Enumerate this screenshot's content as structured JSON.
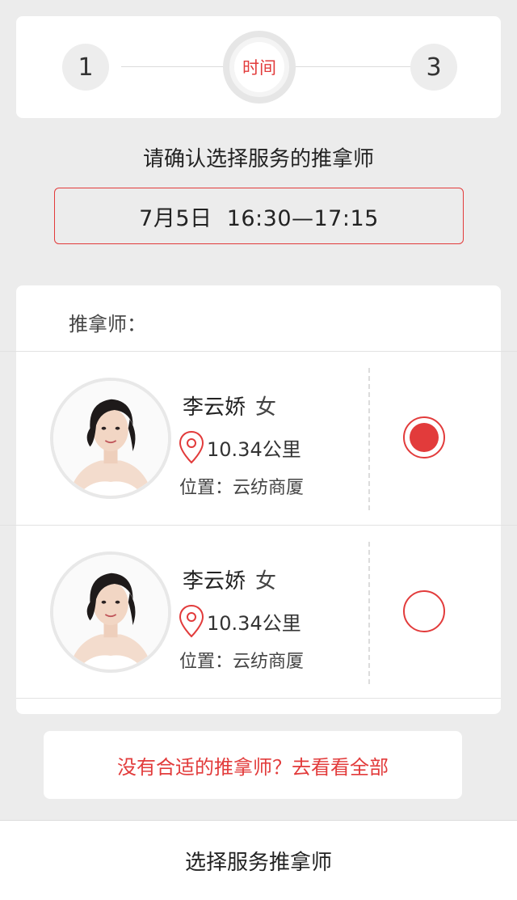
{
  "stepper": {
    "step1": "1",
    "step2": "时间",
    "step3": "3"
  },
  "confirm": {
    "title": "请确认选择服务的推拿师",
    "time_slot": "7月5日  16:30—17:15"
  },
  "list": {
    "header": "推拿师：",
    "therapists": [
      {
        "name": "李云娇",
        "gender": "女",
        "distance": "10.34公里",
        "location": "位置：云纺商厦",
        "selected": true
      },
      {
        "name": "李云娇",
        "gender": "女",
        "distance": "10.34公里",
        "location": "位置：云纺商厦",
        "selected": false
      }
    ]
  },
  "more_link": "没有合适的推拿师？去看看全部",
  "bottom_button": "选择服务推拿师",
  "colors": {
    "accent": "#e23b3b",
    "background": "#ececec",
    "card": "#ffffff"
  },
  "icons": {
    "location": "map-pin-icon",
    "radio_selected": "radio-checked-icon",
    "radio_unselected": "radio-unchecked-icon"
  }
}
